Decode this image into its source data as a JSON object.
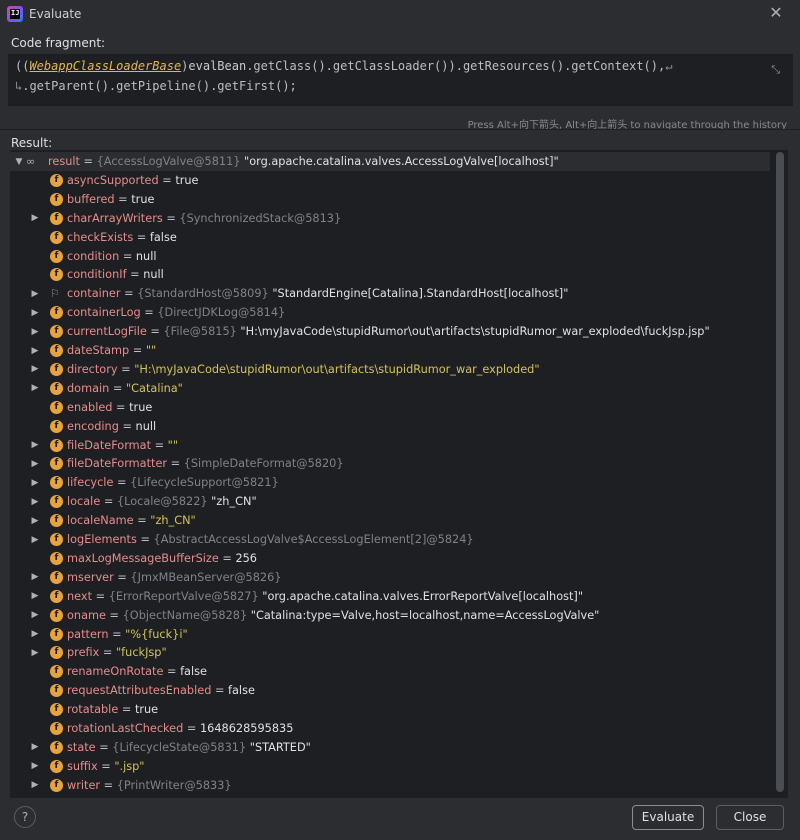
{
  "window": {
    "title": "Evaluate"
  },
  "code": {
    "label": "Code fragment:",
    "line1_prefix": "((",
    "line1_class": "WebappClassLoaderBase",
    "line1_suffix": ")",
    "line1_var": "evalBean",
    "line1_rest": ".getClass().getClassLoader()).getResources().getContext(),",
    "line1_wrap": "↵",
    "line2_wrap": "↳",
    "line2": ".getParent().getPipeline().getFirst();"
  },
  "hint": "Press Alt+向下箭头, Alt+向上箭头 to navigate through the history",
  "result": {
    "label": "Result:",
    "rows": [
      {
        "icon": "oo",
        "arrow": "open",
        "name": "result",
        "eq": " = ",
        "type": "{AccessLogValve@5811}",
        "value": " \"org.apache.catalina.valves.AccessLogValve[localhost]\"",
        "vclass": "plain"
      },
      {
        "icon": "f",
        "arrow": "",
        "name": "asyncSupported",
        "eq": " = ",
        "type": "",
        "value": "true",
        "vclass": "plain"
      },
      {
        "icon": "f",
        "arrow": "",
        "name": "buffered",
        "eq": " = ",
        "type": "",
        "value": "true",
        "vclass": "plain"
      },
      {
        "icon": "f",
        "arrow": "closed",
        "name": "charArrayWriters",
        "eq": " = ",
        "type": "{SynchronizedStack@5813}",
        "value": "",
        "vclass": "plain"
      },
      {
        "icon": "f",
        "arrow": "",
        "name": "checkExists",
        "eq": " = ",
        "type": "",
        "value": "false",
        "vclass": "plain"
      },
      {
        "icon": "f",
        "arrow": "",
        "name": "condition",
        "eq": " = ",
        "type": "",
        "value": "null",
        "vclass": "plain"
      },
      {
        "icon": "f",
        "arrow": "",
        "name": "conditionIf",
        "eq": " = ",
        "type": "",
        "value": "null",
        "vclass": "plain"
      },
      {
        "icon": "flag",
        "arrow": "closed",
        "name": "container",
        "eq": " = ",
        "type": "{StandardHost@5809}",
        "value": " \"StandardEngine[Catalina].StandardHost[localhost]\"",
        "vclass": "plain"
      },
      {
        "icon": "f",
        "arrow": "closed",
        "name": "containerLog",
        "eq": " = ",
        "type": "{DirectJDKLog@5814}",
        "value": "",
        "vclass": "plain"
      },
      {
        "icon": "f",
        "arrow": "closed",
        "name": "currentLogFile",
        "eq": " = ",
        "type": "{File@5815}",
        "value": " \"H:\\myJavaCode\\stupidRumor\\out\\artifacts\\stupidRumor_war_exploded\\fuckJsp.jsp\"",
        "vclass": "plain"
      },
      {
        "icon": "f",
        "arrow": "closed",
        "name": "dateStamp",
        "eq": " = ",
        "type": "",
        "value": "\"\"",
        "vclass": "strv"
      },
      {
        "icon": "f",
        "arrow": "closed",
        "name": "directory",
        "eq": " = ",
        "type": "",
        "value": "\"H:\\myJavaCode\\stupidRumor\\out\\artifacts\\stupidRumor_war_exploded\"",
        "vclass": "strv"
      },
      {
        "icon": "f",
        "arrow": "closed",
        "name": "domain",
        "eq": " = ",
        "type": "",
        "value": "\"Catalina\"",
        "vclass": "strv"
      },
      {
        "icon": "f",
        "arrow": "",
        "name": "enabled",
        "eq": " = ",
        "type": "",
        "value": "true",
        "vclass": "plain"
      },
      {
        "icon": "f",
        "arrow": "",
        "name": "encoding",
        "eq": " = ",
        "type": "",
        "value": "null",
        "vclass": "plain"
      },
      {
        "icon": "f",
        "arrow": "closed",
        "name": "fileDateFormat",
        "eq": " = ",
        "type": "",
        "value": "\"\"",
        "vclass": "strv"
      },
      {
        "icon": "f",
        "arrow": "closed",
        "name": "fileDateFormatter",
        "eq": " = ",
        "type": "{SimpleDateFormat@5820}",
        "value": "",
        "vclass": "plain"
      },
      {
        "icon": "f",
        "arrow": "closed",
        "name": "lifecycle",
        "eq": " = ",
        "type": "{LifecycleSupport@5821}",
        "value": "",
        "vclass": "plain"
      },
      {
        "icon": "f",
        "arrow": "closed",
        "name": "locale",
        "eq": " = ",
        "type": "{Locale@5822}",
        "value": " \"zh_CN\"",
        "vclass": "plain"
      },
      {
        "icon": "f",
        "arrow": "closed",
        "name": "localeName",
        "eq": " = ",
        "type": "",
        "value": "\"zh_CN\"",
        "vclass": "strv"
      },
      {
        "icon": "f",
        "arrow": "closed",
        "name": "logElements",
        "eq": " = ",
        "type": "{AbstractAccessLogValve$AccessLogElement[2]@5824}",
        "value": "",
        "vclass": "plain"
      },
      {
        "icon": "f",
        "arrow": "",
        "name": "maxLogMessageBufferSize",
        "eq": " = ",
        "type": "",
        "value": "256",
        "vclass": "plain"
      },
      {
        "icon": "f",
        "arrow": "closed",
        "name": "mserver",
        "eq": " = ",
        "type": "{JmxMBeanServer@5826}",
        "value": "",
        "vclass": "plain"
      },
      {
        "icon": "f",
        "arrow": "closed",
        "name": "next",
        "eq": " = ",
        "type": "{ErrorReportValve@5827}",
        "value": " \"org.apache.catalina.valves.ErrorReportValve[localhost]\"",
        "vclass": "plain"
      },
      {
        "icon": "f",
        "arrow": "closed",
        "name": "oname",
        "eq": " = ",
        "type": "{ObjectName@5828}",
        "value": " \"Catalina:type=Valve,host=localhost,name=AccessLogValve\"",
        "vclass": "plain"
      },
      {
        "icon": "f",
        "arrow": "closed",
        "name": "pattern",
        "eq": " = ",
        "type": "",
        "value": "\"%{fuck}i\"",
        "vclass": "strv"
      },
      {
        "icon": "f",
        "arrow": "closed",
        "name": "prefix",
        "eq": " = ",
        "type": "",
        "value": "\"fuckJsp\"",
        "vclass": "strv"
      },
      {
        "icon": "f",
        "arrow": "",
        "name": "renameOnRotate",
        "eq": " = ",
        "type": "",
        "value": "false",
        "vclass": "plain"
      },
      {
        "icon": "f",
        "arrow": "",
        "name": "requestAttributesEnabled",
        "eq": " = ",
        "type": "",
        "value": "false",
        "vclass": "plain"
      },
      {
        "icon": "f",
        "arrow": "",
        "name": "rotatable",
        "eq": " = ",
        "type": "",
        "value": "true",
        "vclass": "plain"
      },
      {
        "icon": "f",
        "arrow": "",
        "name": "rotationLastChecked",
        "eq": " = ",
        "type": "",
        "value": "1648628595835",
        "vclass": "plain"
      },
      {
        "icon": "f",
        "arrow": "closed",
        "name": "state",
        "eq": " = ",
        "type": "{LifecycleState@5831}",
        "value": " \"STARTED\"",
        "vclass": "plain"
      },
      {
        "icon": "f",
        "arrow": "closed",
        "name": "suffix",
        "eq": " = ",
        "type": "",
        "value": "\".jsp\"",
        "vclass": "strv"
      },
      {
        "icon": "f",
        "arrow": "closed",
        "name": "writer",
        "eq": " = ",
        "type": "{PrintWriter@5833}",
        "value": "",
        "vclass": "plain"
      }
    ]
  },
  "buttons": {
    "help": "?",
    "evaluate": "Evaluate",
    "close": "Close"
  }
}
